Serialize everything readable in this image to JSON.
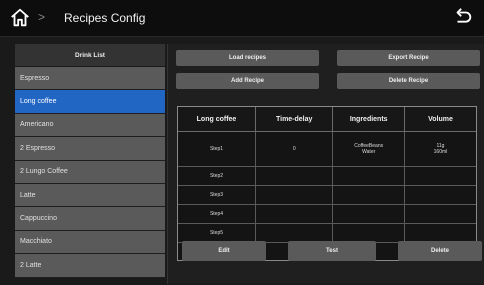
{
  "header": {
    "title": "Recipes Config",
    "separator": ">"
  },
  "sidebar": {
    "header": "Drink List",
    "items": [
      {
        "label": "Espresso",
        "active": false
      },
      {
        "label": "Long coffee",
        "active": true
      },
      {
        "label": "Americano",
        "active": false
      },
      {
        "label": "2 Espresso",
        "active": false
      },
      {
        "label": "2 Lungo Coffee",
        "active": false
      },
      {
        "label": "Latte",
        "active": false
      },
      {
        "label": "Cappuccino",
        "active": false
      },
      {
        "label": "Macchiato",
        "active": false
      },
      {
        "label": "2 Latte",
        "active": false
      }
    ]
  },
  "toolbar": {
    "load_label": "Load recipes",
    "export_label": "Export Recipe",
    "add_label": "Add Recipe",
    "delete_recipe_label": "Delete Recipe"
  },
  "table": {
    "headers": [
      "Long coffee",
      "Time-delay",
      "Ingredients",
      "Volume"
    ],
    "rows": [
      [
        "Step1",
        "0",
        "CoffeeBeans\nWater",
        "11g\n160ml"
      ],
      [
        "Step2",
        "",
        "",
        ""
      ],
      [
        "Step3",
        "",
        "",
        ""
      ],
      [
        "Step4",
        "",
        "",
        ""
      ],
      [
        "Step5",
        "",
        "",
        ""
      ],
      [
        "Step6",
        "",
        "",
        ""
      ]
    ]
  },
  "actions": {
    "edit_label": "Edit",
    "test_label": "Test",
    "delete_label": "Delete"
  },
  "colors": {
    "accent": "#2266c4",
    "button": "#5a5a5a",
    "background": "#1a1a1a"
  }
}
